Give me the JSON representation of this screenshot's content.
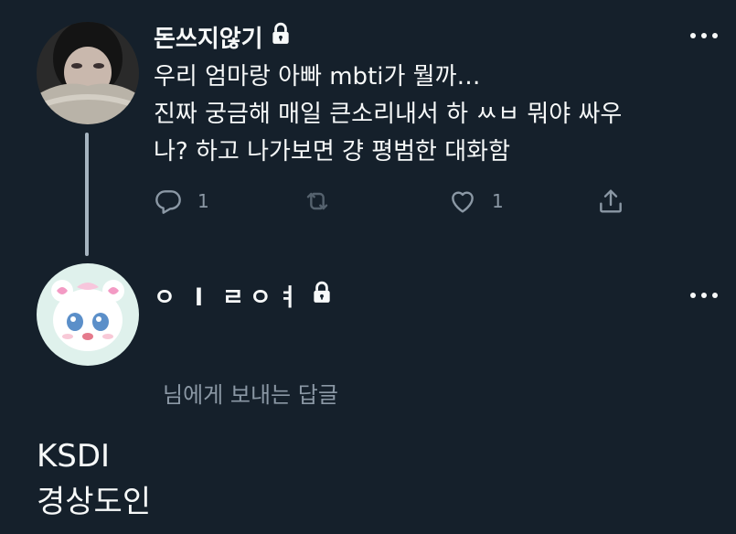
{
  "tweet": {
    "author_name": "돈쓰지않기",
    "text_lines": [
      "우리 엄마랑 아빠 mbti가 뭘까…",
      "진짜 궁금해 매일 큰소리내서 하 ㅆㅂ 뭐야 싸우",
      "나? 하고 나가보면 걍 평범한 대화함"
    ],
    "reply_count": "1",
    "retweet_count": "",
    "like_count": "1",
    "locked_icon": "lock-icon"
  },
  "reply": {
    "author_name": "ㅇ l ㄹㅇㅕ",
    "reply_to_label": "님에게 보내는 답글",
    "text_lines": [
      "KSDI",
      "경상도인"
    ],
    "locked_icon": "lock-icon"
  },
  "colors": {
    "background": "#15202b",
    "text_primary": "#f7f9f9",
    "text_secondary": "#8b98a5",
    "thread_line": "#a6b4c0"
  }
}
